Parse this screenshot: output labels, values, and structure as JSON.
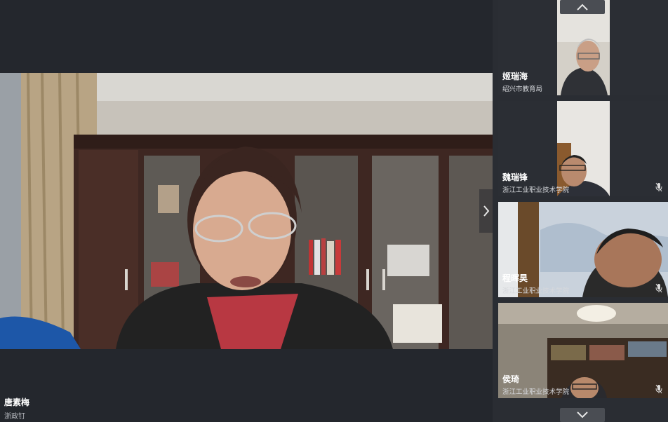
{
  "main": {
    "speaker_name": "唐素梅",
    "speaker_org": "浙政钉"
  },
  "participants": [
    {
      "name": "姬瑞海",
      "org": "绍兴市教育局",
      "muted": false
    },
    {
      "name": "魏瑞锋",
      "org": "浙江工业职业技术学院",
      "muted": true
    },
    {
      "name": "程晖昊",
      "org": "浙江工业职业技术学院",
      "muted": true
    },
    {
      "name": "侯琦",
      "org": "浙江工业职业技术学院",
      "muted": true
    }
  ],
  "icons": {
    "next": "chevron-right-icon",
    "scroll_up": "chevron-up-icon",
    "scroll_down": "chevron-down-icon",
    "mic": "mic-off-icon"
  },
  "colors": {
    "background": "#24272d",
    "sidebar": "#2a2d33",
    "org_text": "#b9bcc2"
  }
}
